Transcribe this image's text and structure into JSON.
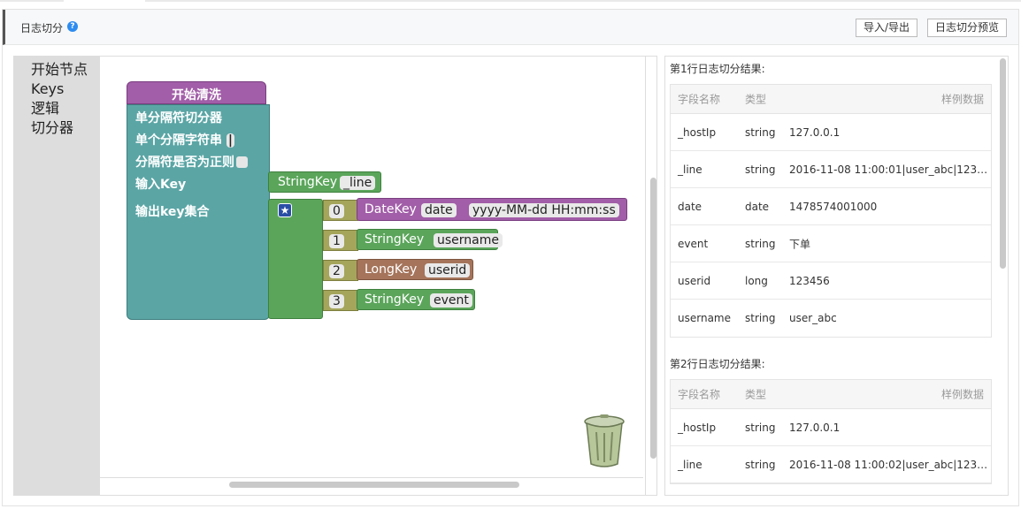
{
  "header": {
    "title": "日志切分",
    "help_icon": "question-icon",
    "import_export_label": "导入/导出",
    "preview_label": "日志切分预览"
  },
  "toolbox": {
    "items": [
      "开始节点",
      "Keys",
      "逻辑",
      "切分器"
    ]
  },
  "blocks": {
    "start": "开始清洗",
    "splitter": {
      "title": "单分隔符切分器",
      "sep_label": "单个分隔字符串",
      "sep_value": "|",
      "regex_label": "分隔符是否为正则",
      "input_label": "输入Key",
      "output_label": "输出key集合"
    },
    "input_key": {
      "type": "StringKey",
      "name": "_line"
    },
    "output_keys": [
      {
        "index": "0",
        "type": "DateKey",
        "name": "date",
        "format": "yyyy-MM-dd HH:mm:ss"
      },
      {
        "index": "1",
        "type": "StringKey",
        "name": "username"
      },
      {
        "index": "2",
        "type": "LongKey",
        "name": "userid"
      },
      {
        "index": "3",
        "type": "StringKey",
        "name": "event"
      }
    ]
  },
  "results": [
    {
      "title": "第1行日志切分结果:",
      "columns": [
        "字段名称",
        "类型",
        "样例数据"
      ],
      "rows": [
        [
          "_hostIp",
          "string",
          "127.0.0.1"
        ],
        [
          "_line",
          "string",
          "2016-11-08 11:00:01|user_abc|123…"
        ],
        [
          "date",
          "date",
          "1478574001000"
        ],
        [
          "event",
          "string",
          "下单"
        ],
        [
          "userid",
          "long",
          "123456"
        ],
        [
          "username",
          "string",
          "user_abc"
        ]
      ]
    },
    {
      "title": "第2行日志切分结果:",
      "columns": [
        "字段名称",
        "类型",
        "样例数据"
      ],
      "rows": [
        [
          "_hostIp",
          "string",
          "127.0.0.1"
        ],
        [
          "_line",
          "string",
          "2016-11-08 11:00:02|user_abc|123…"
        ]
      ]
    }
  ],
  "colors": {
    "start_block": "#a25ea8",
    "splitter_block": "#5ba5a5",
    "key_block": "#5ba55b",
    "index_block": "#a5a55b",
    "long_key_block": "#a5745b",
    "help_icon": "#2d8cf0"
  }
}
